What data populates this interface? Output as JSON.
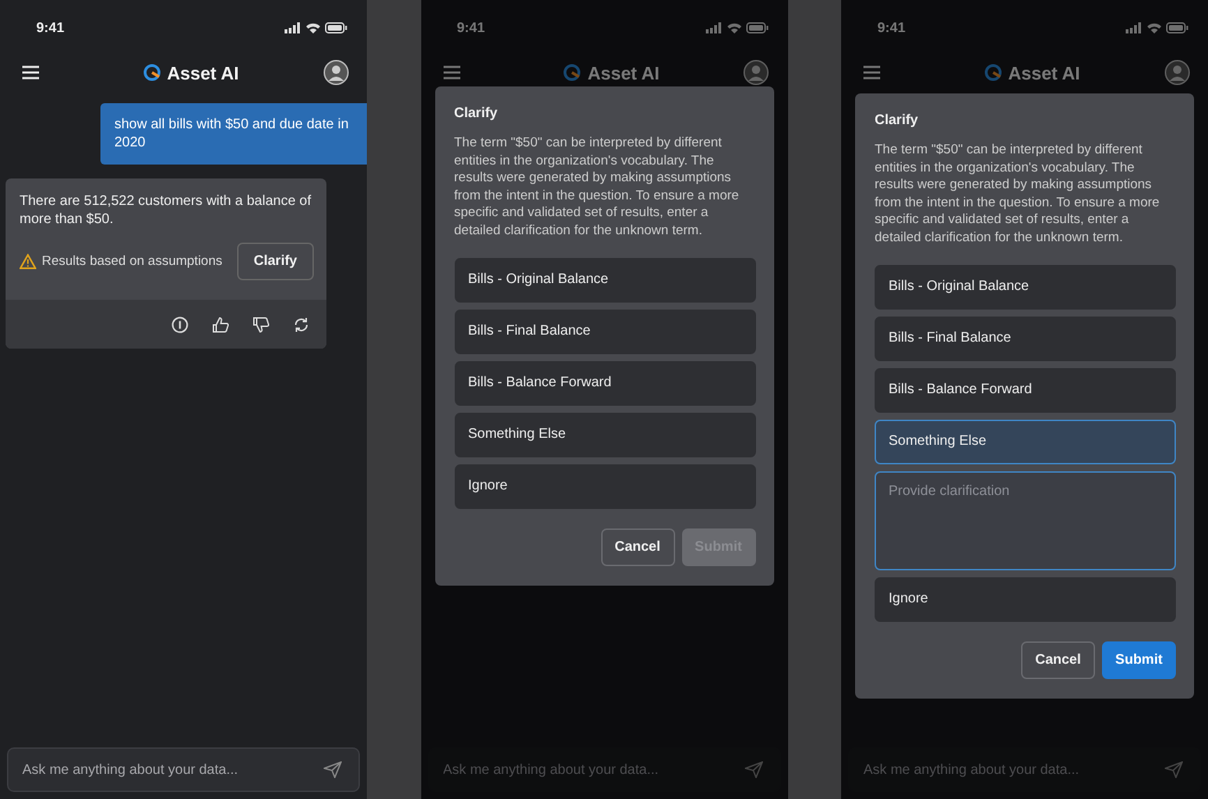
{
  "screens": [
    {
      "status_time": "9:41",
      "app_title": "Asset AI",
      "messages": [
        {
          "kind": "user",
          "text": "show all bills with $50 and due date in 2020"
        },
        {
          "kind": "answer",
          "text": "There are 512,522 customers with a balance of more than $50.",
          "warning": "Results based on assumptions",
          "action": "Clarify"
        }
      ],
      "input": {
        "placeholder": "Ask me anything about your data..."
      }
    },
    {
      "status_time": "9:41",
      "app_title": "Asset AI",
      "input": {
        "placeholder": "Ask me anything about your data..."
      },
      "dialog": {
        "title": "Clarify",
        "body": "The term \"$50\" can be interpreted by different entities in the organization's vocabulary. The results were generated by making assumptions from the intent in the question. To ensure a more specific and validated set of results, enter a detailed clarification for the unknown term.",
        "options": [
          {
            "kind": "option",
            "label": "Bills - Original Balance",
            "selected": false
          },
          {
            "kind": "option",
            "label": "Bills - Final Balance",
            "selected": false
          },
          {
            "kind": "option",
            "label": "Bills - Balance Forward",
            "selected": false
          },
          {
            "kind": "option",
            "label": "Something Else",
            "selected": false
          },
          {
            "kind": "option",
            "label": "Ignore",
            "selected": false
          }
        ],
        "buttons": [
          {
            "kind": "secondary",
            "label": "Cancel",
            "disabled": false
          },
          {
            "kind": "primary",
            "label": "Submit",
            "disabled": true
          }
        ]
      }
    },
    {
      "status_time": "9:41",
      "app_title": "Asset AI",
      "input": {
        "placeholder": "Ask me anything about your data..."
      },
      "dialog": {
        "title": "Clarify",
        "body": "The term \"$50\" can be interpreted by different entities in the organization's vocabulary. The results were generated by making assumptions from the intent in the question. To ensure a more specific and validated set of results, enter a detailed clarification for the unknown term.",
        "options": [
          {
            "kind": "option",
            "label": "Bills - Original Balance",
            "selected": false
          },
          {
            "kind": "option",
            "label": "Bills - Final Balance",
            "selected": false
          },
          {
            "kind": "option",
            "label": "Bills - Balance Forward",
            "selected": false
          },
          {
            "kind": "option",
            "label": "Something Else",
            "selected": true
          },
          {
            "kind": "field",
            "placeholder": "Provide clarification"
          },
          {
            "kind": "option",
            "label": "Ignore",
            "selected": false
          }
        ],
        "buttons": [
          {
            "kind": "secondary",
            "label": "Cancel",
            "disabled": false
          },
          {
            "kind": "primary",
            "label": "Submit",
            "disabled": false
          }
        ]
      }
    }
  ]
}
